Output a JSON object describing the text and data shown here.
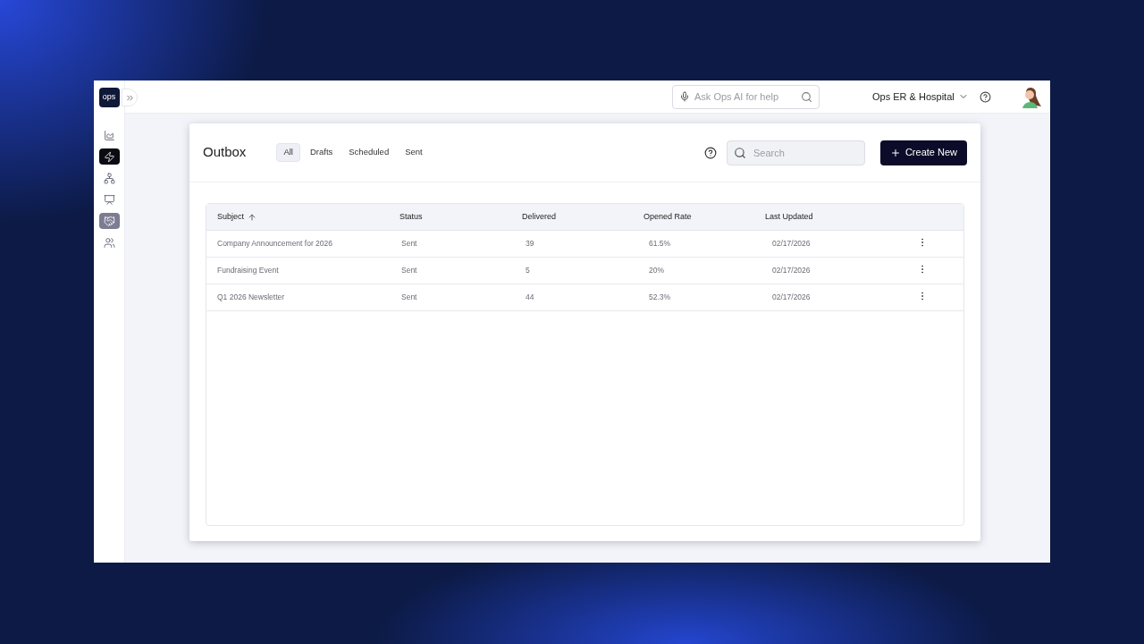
{
  "logo": "ops",
  "sidebar": {
    "items": [
      {
        "selected": false,
        "highlighted": false
      },
      {
        "selected": false,
        "highlighted": true
      },
      {
        "selected": false,
        "highlighted": false
      },
      {
        "selected": false,
        "highlighted": false
      },
      {
        "selected": true,
        "highlighted": false
      },
      {
        "selected": false,
        "highlighted": false
      }
    ]
  },
  "topbar": {
    "ai_search": {
      "placeholder": "Ask Ops AI for help"
    },
    "organization": "Ops ER & Hospital"
  },
  "page": {
    "title": "Outbox",
    "tabs": [
      {
        "label": "All",
        "selected": true
      },
      {
        "label": "Drafts",
        "selected": false
      },
      {
        "label": "Scheduled",
        "selected": false
      },
      {
        "label": "Sent",
        "selected": false
      }
    ],
    "search": {
      "placeholder": "Search"
    },
    "create_button": "Create New"
  },
  "table": {
    "columns": [
      "Subject",
      "Status",
      "Delivered",
      "Opened Rate",
      "Last Updated"
    ],
    "rows": [
      {
        "subject": "Company Announcement for 2026",
        "status": "Sent",
        "delivered": "39",
        "opened_rate": "61.5%",
        "last_updated": "02/17/2026"
      },
      {
        "subject": "Fundraising Event",
        "status": "Sent",
        "delivered": "5",
        "opened_rate": "20%",
        "last_updated": "02/17/2026"
      },
      {
        "subject": "Q1 2026 Newsletter",
        "status": "Sent",
        "delivered": "44",
        "opened_rate": "52.3%",
        "last_updated": "02/17/2026"
      }
    ]
  }
}
